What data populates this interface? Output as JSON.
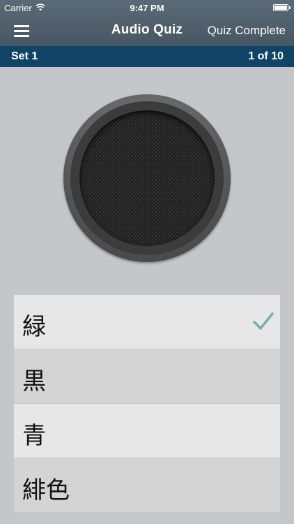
{
  "status": {
    "carrier": "Carrier",
    "time": "9:47 PM"
  },
  "nav": {
    "title": "Audio Quiz",
    "action": "Quiz Complete"
  },
  "setbar": {
    "set": "Set 1",
    "progress": "1 of 10"
  },
  "answers": [
    {
      "text": "緑",
      "checked": true
    },
    {
      "text": "黒",
      "checked": false
    },
    {
      "text": "青",
      "checked": false
    },
    {
      "text": "緋色",
      "checked": false
    }
  ],
  "colors": {
    "nav_bar": "#4f5f6c",
    "set_bar": "#0f4466",
    "background": "#c3c7ca",
    "check": "#6fb3a0"
  },
  "icons": [
    "menu-icon",
    "wifi-icon",
    "battery-icon",
    "speaker-icon",
    "checkmark-icon"
  ]
}
